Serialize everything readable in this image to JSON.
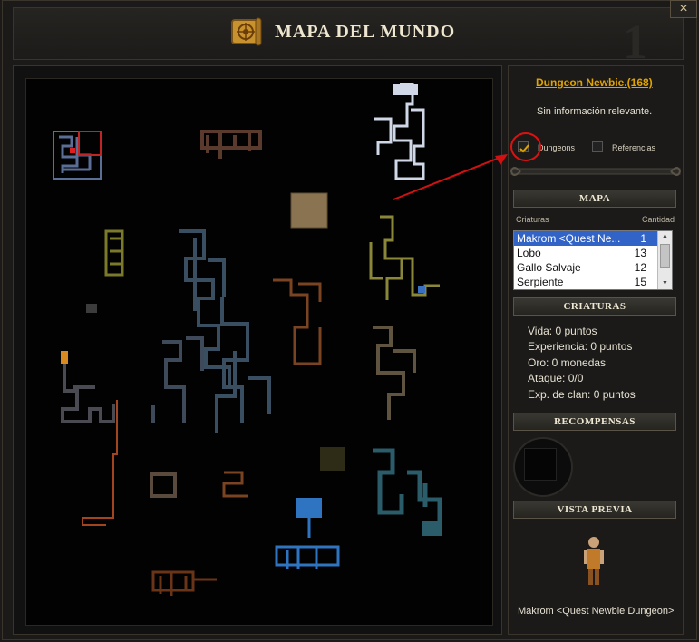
{
  "window": {
    "title": "MAPA DEL MUNDO",
    "page_number": "1",
    "close_label": "×"
  },
  "zone": {
    "link": "Dungeon Newbie.(168)",
    "info": "Sin información relevante."
  },
  "filters": {
    "dungeons": {
      "label": "Dungeons",
      "checked": true
    },
    "referencias": {
      "label": "Referencias",
      "checked": false
    }
  },
  "sections": {
    "mapa": "MAPA",
    "criaturas": "CRIATURAS",
    "recompensas": "RECOMPENSAS",
    "vista_previa": "VISTA PREVIA"
  },
  "creature_list": {
    "col_name": "Criaturas",
    "col_count": "Cantidad",
    "rows": [
      {
        "name": "Makrom <Quest Ne...",
        "count": "1",
        "selected": true
      },
      {
        "name": "Lobo",
        "count": "13",
        "selected": false
      },
      {
        "name": "Gallo Salvaje",
        "count": "12",
        "selected": false
      },
      {
        "name": "Serpiente",
        "count": "15",
        "selected": false
      }
    ]
  },
  "stats": {
    "vida": "Vida: 0 puntos",
    "experiencia": "Experiencia: 0 puntos",
    "oro": "Oro: 0 monedas",
    "ataque": "Ataque: 0/0",
    "exp_clan": "Exp. de clan: 0 puntos"
  },
  "preview": {
    "caption": "Makrom <Quest Newbie Dungeon>"
  },
  "colors": {
    "accent_gold": "#e0a300",
    "highlight_red": "#d11111",
    "selection_blue": "#3264c8"
  },
  "icons": {
    "title": "scroll-map-icon",
    "close": "close-icon",
    "check": "checkmark-icon",
    "arrow": "red-arrow-annotation"
  }
}
